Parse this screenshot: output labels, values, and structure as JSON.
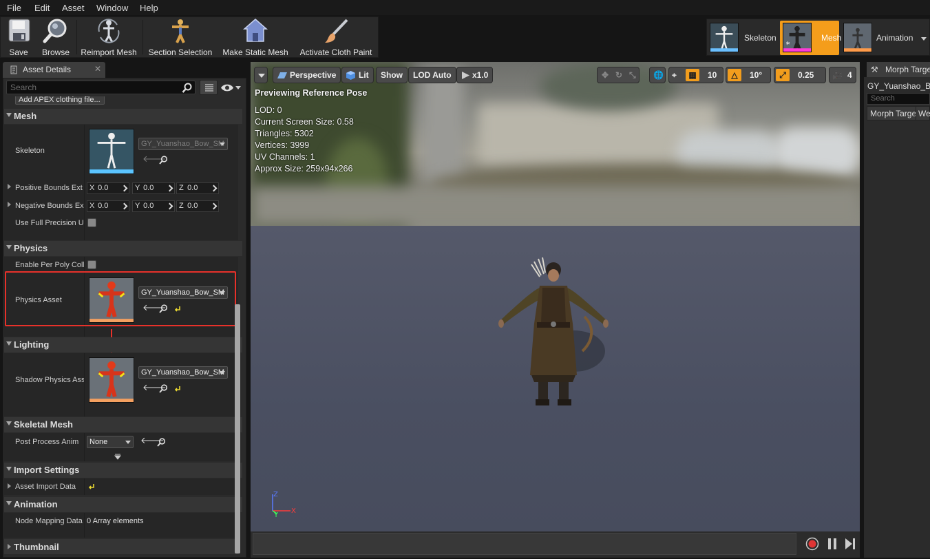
{
  "menu": [
    "File",
    "Edit",
    "Asset",
    "Window",
    "Help"
  ],
  "toolbar": [
    {
      "label": "Save",
      "icon": "save-icon"
    },
    {
      "label": "Browse",
      "icon": "browse-icon"
    },
    {
      "label": "Reimport Mesh",
      "icon": "reimport-icon"
    },
    {
      "label": "Section Selection",
      "icon": "section-selection-icon"
    },
    {
      "label": "Make Static Mesh",
      "icon": "make-static-mesh-icon"
    },
    {
      "label": "Activate Cloth Paint",
      "icon": "cloth-paint-icon"
    }
  ],
  "modes": [
    {
      "label": "Skeleton",
      "active": false
    },
    {
      "label": "Mesh",
      "active": true
    },
    {
      "label": "Animation",
      "active": false
    }
  ],
  "details": {
    "tab_label": "Asset Details",
    "search_placeholder": "Search",
    "apex_button": "Add APEX clothing file...",
    "categories": {
      "mesh": "Mesh",
      "physics": "Physics",
      "lighting": "Lighting",
      "skeletal_mesh": "Skeletal Mesh",
      "import_settings": "Import Settings",
      "animation": "Animation",
      "thumbnail": "Thumbnail"
    },
    "rows": {
      "skeleton": "Skeleton",
      "skeleton_value": "GY_Yuanshao_Bow_SM",
      "pos_bounds": "Positive Bounds Ext",
      "neg_bounds": "Negative Bounds Ex",
      "x": "X",
      "y": "Y",
      "z": "Z",
      "zero": "0.0",
      "full_precision": "Use Full Precision U",
      "per_poly": "Enable Per Poly Coll",
      "physics_asset": "Physics Asset",
      "physics_asset_value": "GY_Yuanshao_Bow_SM",
      "shadow_physics": "Shadow Physics Ass",
      "shadow_physics_value": "GY_Yuanshao_Bow_SM",
      "post_process": "Post Process Anim",
      "post_process_value": "None",
      "asset_import": "Asset Import Data",
      "node_mapping": "Node Mapping Data",
      "node_mapping_value": "0 Array elements"
    }
  },
  "viewport": {
    "perspective": "Perspective",
    "lit": "Lit",
    "show": "Show",
    "lod": "LOD Auto",
    "play_rate": "x1.0",
    "grid_value": "10",
    "angle_value": "10°",
    "scale_value": "0.25",
    "camera_speed": "4",
    "preview_label": "Previewing Reference Pose",
    "stats": [
      "LOD: 0",
      "Current Screen Size: 0.58",
      "Triangles: 5302",
      "Vertices: 3999",
      "UV Channels: 1",
      "Approx Size: 259x94x266"
    ],
    "axes": {
      "x": "X",
      "y": "Y",
      "z": "Z"
    }
  },
  "morph": {
    "tab_label": "Morph Targe",
    "asset_name": "GY_Yuanshao_B",
    "search_placeholder": "Search",
    "col1": "Morph Targe",
    "col2": "We"
  },
  "colors": {
    "highlight": "#e8312a",
    "accent": "#f29d1d"
  }
}
